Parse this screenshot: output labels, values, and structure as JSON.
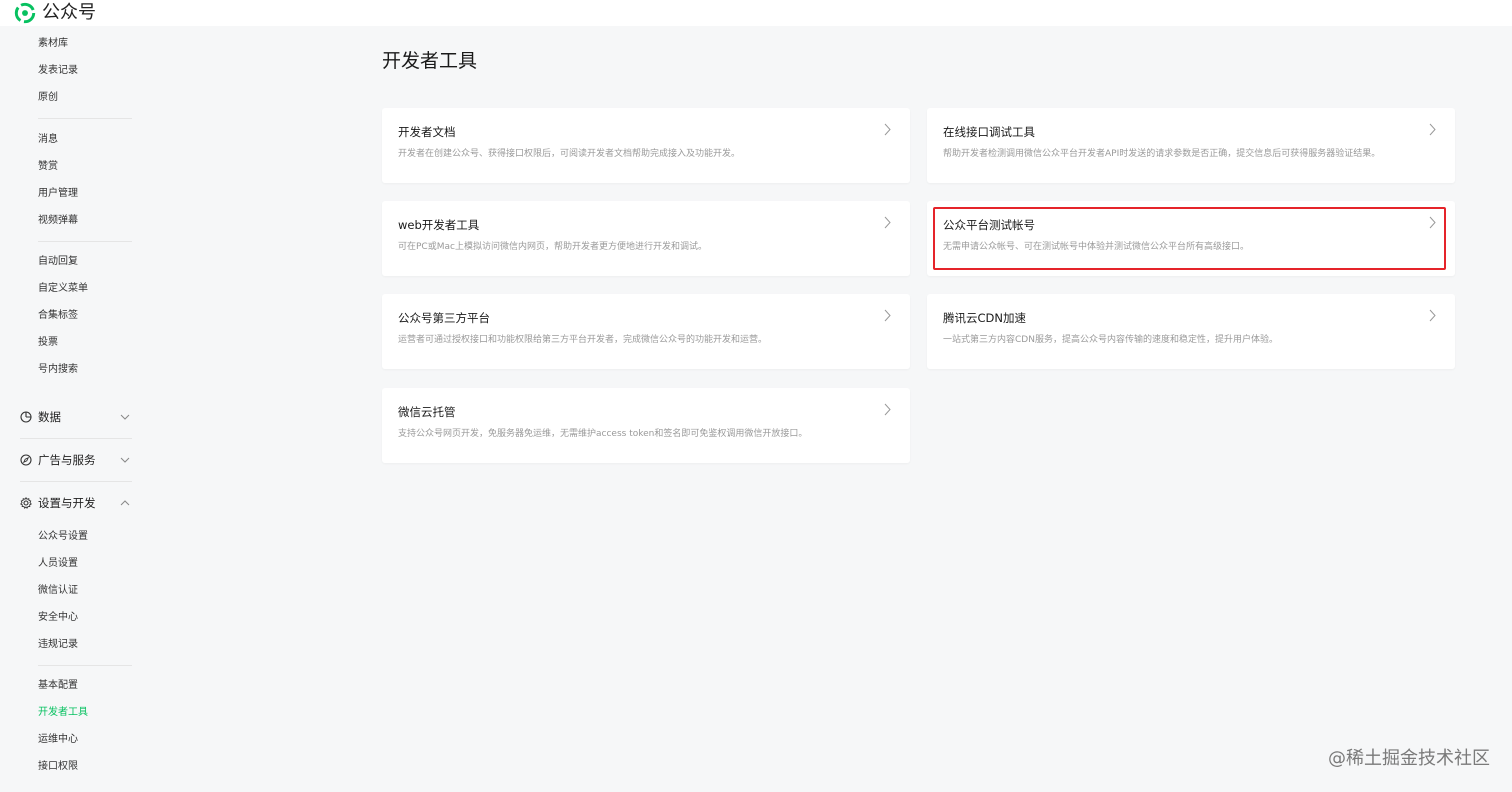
{
  "app": {
    "name": "公众号"
  },
  "sidebar": {
    "group_top": [
      "素材库",
      "发表记录",
      "原创"
    ],
    "group_interact": [
      "消息",
      "赞赏",
      "用户管理",
      "视频弹幕"
    ],
    "group_func": [
      "自动回复",
      "自定义菜单",
      "合集标签",
      "投票",
      "号内搜索"
    ],
    "sections": {
      "data": "数据",
      "ads": "广告与服务",
      "settings": "设置与开发"
    },
    "group_settings": [
      "公众号设置",
      "人员设置",
      "微信认证",
      "安全中心",
      "违规记录"
    ],
    "group_dev": [
      "基本配置",
      "开发者工具",
      "运维中心",
      "接口权限"
    ],
    "active_item": "开发者工具"
  },
  "main": {
    "title": "开发者工具",
    "cards": [
      {
        "title": "开发者文档",
        "desc": "开发者在创建公众号、获得接口权限后，可阅读开发者文档帮助完成接入及功能开发。"
      },
      {
        "title": "在线接口调试工具",
        "desc": "帮助开发者检测调用微信公众平台开发者API时发送的请求参数是否正确，提交信息后可获得服务器验证结果。"
      },
      {
        "title": "web开发者工具",
        "desc": "可在PC或Mac上模拟访问微信内网页，帮助开发者更方便地进行开发和调试。"
      },
      {
        "title": "公众平台测试帐号",
        "desc": "无需申请公众帐号、可在测试帐号中体验并测试微信公众平台所有高级接口。"
      },
      {
        "title": "公众号第三方平台",
        "desc": "运营者可通过授权接口和功能权限给第三方平台开发者，完成微信公众号的功能开发和运营。"
      },
      {
        "title": "腾讯云CDN加速",
        "desc": "一站式第三方内容CDN服务，提高公众号内容传输的速度和稳定性，提升用户体验。"
      },
      {
        "title": "微信云托管",
        "desc": "支持公众号网页开发，免服务器免运维，无需维护access token和签名即可免鉴权调用微信开放接口。"
      }
    ]
  },
  "watermark": "@稀土掘金技术社区",
  "colors": {
    "accent": "#07c160",
    "highlight": "#e5242a",
    "background": "#f6f7f8"
  }
}
